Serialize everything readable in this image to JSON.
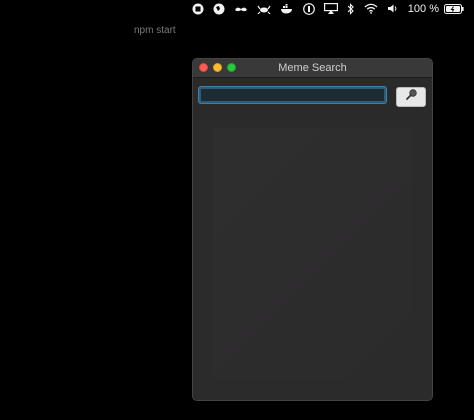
{
  "menubar": {
    "icons": [
      "record-icon",
      "globe-icon",
      "mustache-icon",
      "crab-icon",
      "whale-icon",
      "password-icon",
      "airplay-icon",
      "bluetooth-icon",
      "wifi-icon",
      "volume-icon",
      "battery-icon"
    ],
    "battery_percent": "100 %"
  },
  "terminal": {
    "command": "npm start"
  },
  "window": {
    "title": "Meme Search",
    "search": {
      "value": "",
      "placeholder": ""
    },
    "search_button_icon": "search-icon"
  }
}
